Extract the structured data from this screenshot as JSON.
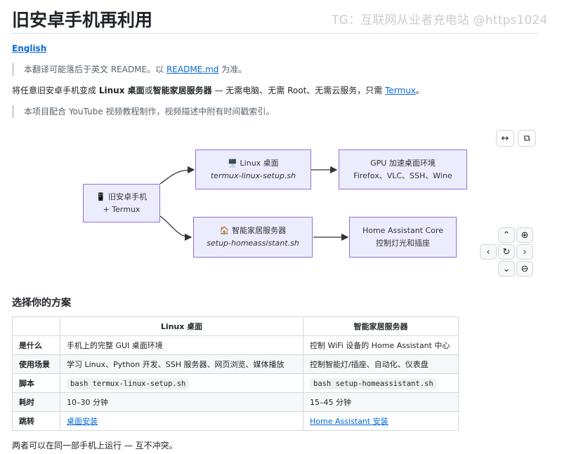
{
  "watermark": "TG：互联网从业者充电站 @https1024",
  "title": "旧安卓手机再利用",
  "language_link": "English",
  "notes": {
    "translation_prefix": "本翻译可能落后于英文 README。以",
    "translation_link": "README.md",
    "translation_suffix": "为准。",
    "youtube": "本项目配合 YouTube 视频教程制作，视频描述中附有时间戳索引。"
  },
  "intro": {
    "prefix": "将任意旧安卓手机变成",
    "linux": "Linux 桌面",
    "or": "或",
    "server": "智能家居服务器",
    "middle": " — 无需电脑、无需 Root、无需云服务，只需",
    "termux": "Termux",
    "suffix": "。"
  },
  "diagram": {
    "toolbar": {
      "expand_icon": "↔",
      "copy_icon": "⧉"
    },
    "nodes": {
      "phone": {
        "icon": "📱",
        "line1": "旧安卓手机",
        "line2": "+ Termux"
      },
      "linux": {
        "icon": "🖥️",
        "line1": "Linux 桌面",
        "line2": "termux-linux-setup.sh"
      },
      "gpu": {
        "line1": "GPU 加速桌面环境",
        "line2": "Firefox、VLC、SSH、Wine"
      },
      "smarthome": {
        "icon": "🏠",
        "line1": "智能家居服务器",
        "line2": "setup-homeassistant.sh"
      },
      "ha": {
        "line1": "Home Assistant Core",
        "line2": "控制灯光和插座"
      }
    },
    "controls": {
      "up": "⌃",
      "zoom_in": "⊕",
      "left": "‹",
      "reset": "↻",
      "right": "›",
      "down": "⌄",
      "zoom_out": "⊖"
    }
  },
  "section_title": "选择你的方案",
  "table": {
    "headers": [
      "",
      "Linux 桌面",
      "智能家居服务器"
    ],
    "rows": [
      {
        "label": "是什么",
        "linux": "手机上的完整 GUI 桌面环境",
        "server": "控制 WiFi 设备的 Home Assistant 中心"
      },
      {
        "label": "使用场景",
        "linux": "学习 Linux、Python 开发、SSH 服务器、网页浏览、媒体播放",
        "server": "控制智能灯/插座、自动化、仪表盘"
      },
      {
        "label": "脚本",
        "linux": "bash termux-linux-setup.sh",
        "server": "bash setup-homeassistant.sh"
      },
      {
        "label": "耗时",
        "linux": "10–30 分钟",
        "server": "15–45 分钟"
      },
      {
        "label": "跳转",
        "linux": "桌面安装",
        "server": "Home Assistant 安装"
      }
    ]
  },
  "footnote": "两者可以在同一部手机上运行 — 互不冲突。"
}
